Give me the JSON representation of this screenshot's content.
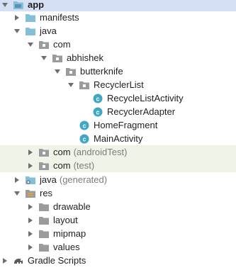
{
  "colors": {
    "selection": "#d5e0f5",
    "test_highlight": "#eef5e8",
    "folder_blue": "#84bfd8",
    "folder_gray": "#9b9b9b",
    "class_teal": "#3fa7c4"
  },
  "tree": {
    "app": {
      "label": "app",
      "icon": "module-folder-icon",
      "expanded": true
    },
    "manifests": {
      "label": "manifests",
      "icon": "folder-icon",
      "expanded": false
    },
    "java": {
      "label": "java",
      "icon": "source-folder-icon",
      "expanded": true
    },
    "com": {
      "label": "com",
      "icon": "package-icon",
      "expanded": true
    },
    "abhishek": {
      "label": "abhishek",
      "icon": "package-icon",
      "expanded": true
    },
    "butterknife": {
      "label": "butterknife",
      "icon": "package-icon",
      "expanded": true
    },
    "recyclerlist": {
      "label": "RecyclerList",
      "icon": "package-icon",
      "expanded": true
    },
    "recyclelistactivity": {
      "label": "RecycleListActivity",
      "icon": "class-icon",
      "badge": "c"
    },
    "recycleradapter": {
      "label": "RecyclerAdapter",
      "icon": "class-icon",
      "badge": "c"
    },
    "homefragment": {
      "label": "HomeFragment",
      "icon": "class-icon",
      "badge": "c"
    },
    "mainactivity": {
      "label": "MainActivity",
      "icon": "class-icon",
      "badge": "c"
    },
    "com_androidtest": {
      "label": "com",
      "suffix": "(androidTest)",
      "icon": "package-icon",
      "expanded": false
    },
    "com_test": {
      "label": "com",
      "suffix": "(test)",
      "icon": "package-icon",
      "expanded": false
    },
    "java_generated": {
      "label": "java",
      "suffix": "(generated)",
      "icon": "generated-folder-icon",
      "expanded": false
    },
    "res": {
      "label": "res",
      "icon": "resources-folder-icon",
      "expanded": true
    },
    "drawable": {
      "label": "drawable",
      "icon": "folder-icon",
      "expanded": false
    },
    "layout": {
      "label": "layout",
      "icon": "folder-icon",
      "expanded": false
    },
    "mipmap": {
      "label": "mipmap",
      "icon": "folder-icon",
      "expanded": false
    },
    "values": {
      "label": "values",
      "icon": "folder-icon",
      "expanded": false
    },
    "gradle_scripts": {
      "label": "Gradle Scripts",
      "icon": "gradle-icon",
      "expanded": false
    }
  }
}
